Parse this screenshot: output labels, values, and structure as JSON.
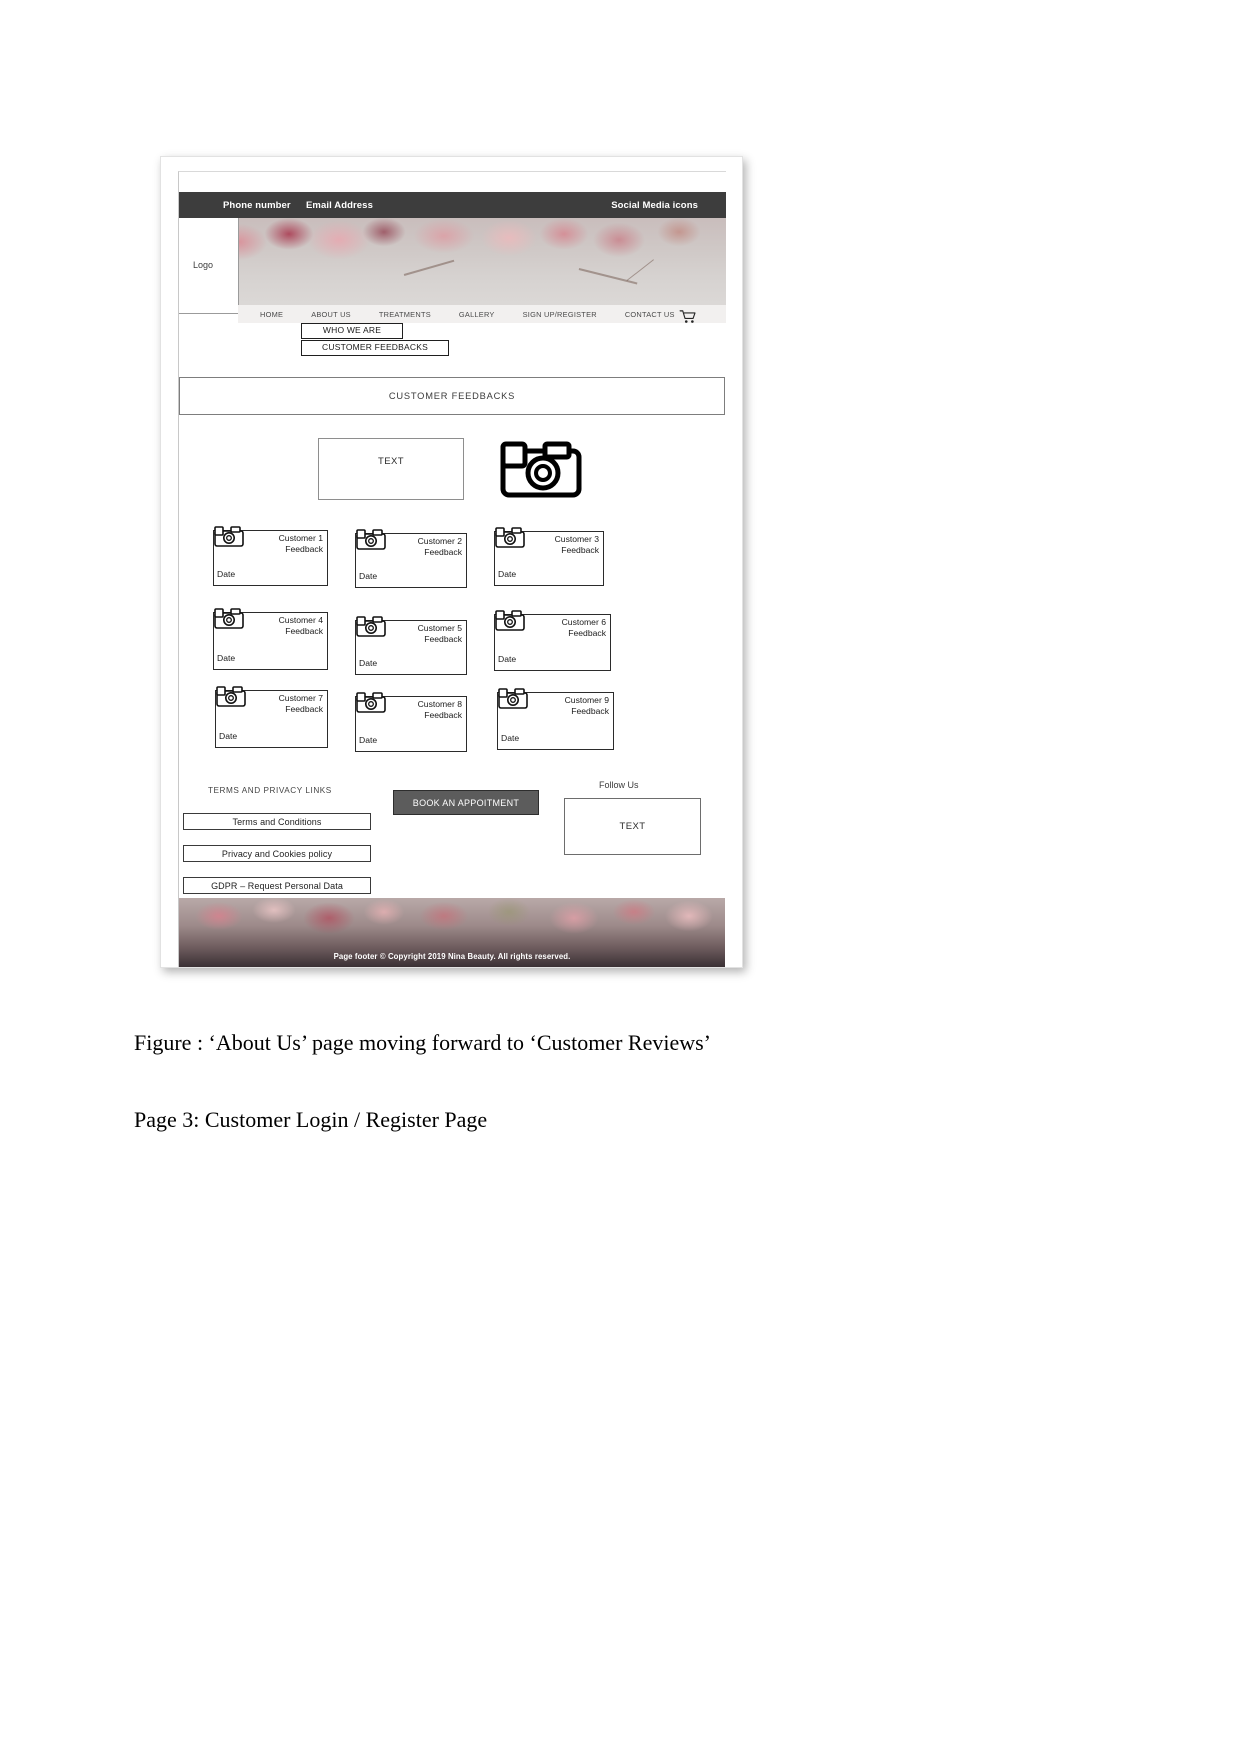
{
  "document": {
    "caption": "Figure : ‘About Us’ page moving forward to ‘Customer Reviews’",
    "page_label": "Page 3: Customer Login / Register Page"
  },
  "wireframe": {
    "utility_bar": {
      "phone": "Phone number",
      "email": "Email Address",
      "social": "Social Media icons",
      "background": "#3d3d3d"
    },
    "logo": {
      "label": "Logo"
    },
    "nav": {
      "items": [
        {
          "label": "HOME"
        },
        {
          "label": "ABOUT US"
        },
        {
          "label": "TREATMENTS"
        },
        {
          "label": "GALLERY"
        },
        {
          "label": "SIGN UP/REGISTER"
        },
        {
          "label": "CONTACT US"
        }
      ],
      "cart_icon": "shopping-cart-icon"
    },
    "dropdown": {
      "items": [
        {
          "label": "WHO WE ARE"
        },
        {
          "label": "CUSTOMER FEEDBACKS"
        }
      ]
    },
    "section_banner": {
      "title": "CUSTOMER FEEDBACKS"
    },
    "intro": {
      "text_box": "TEXT",
      "image_placeholder": "camera-icon"
    },
    "feedback_cards": [
      {
        "name": "Customer 1",
        "feedback": "Feedback",
        "date": "Date"
      },
      {
        "name": "Customer 2",
        "feedback": "Feedback",
        "date": "Date"
      },
      {
        "name": "Customer 3",
        "feedback": "Feedback",
        "date": "Date"
      },
      {
        "name": "Customer 4",
        "feedback": "Feedback",
        "date": "Date"
      },
      {
        "name": "Customer 5",
        "feedback": "Feedback",
        "date": "Date"
      },
      {
        "name": "Customer 6",
        "feedback": "Feedback",
        "date": "Date"
      },
      {
        "name": "Customer 7",
        "feedback": "Feedback",
        "date": "Date"
      },
      {
        "name": "Customer 8",
        "feedback": "Feedback",
        "date": "Date"
      },
      {
        "name": "Customer 9",
        "feedback": "Feedback",
        "date": "Date"
      }
    ],
    "footer": {
      "terms_heading": "TERMS AND PRIVACY LINKS",
      "links": [
        {
          "label": "Terms and Conditions"
        },
        {
          "label": "Privacy and Cookies policy"
        },
        {
          "label": "GDPR – Request Personal Data"
        }
      ],
      "book_button": "BOOK AN APPOITMENT",
      "follow_heading": "Follow Us",
      "follow_box": "TEXT",
      "copyright": "Page footer  © Copyright 2019 Nina  Beauty. All rights reserved."
    }
  }
}
